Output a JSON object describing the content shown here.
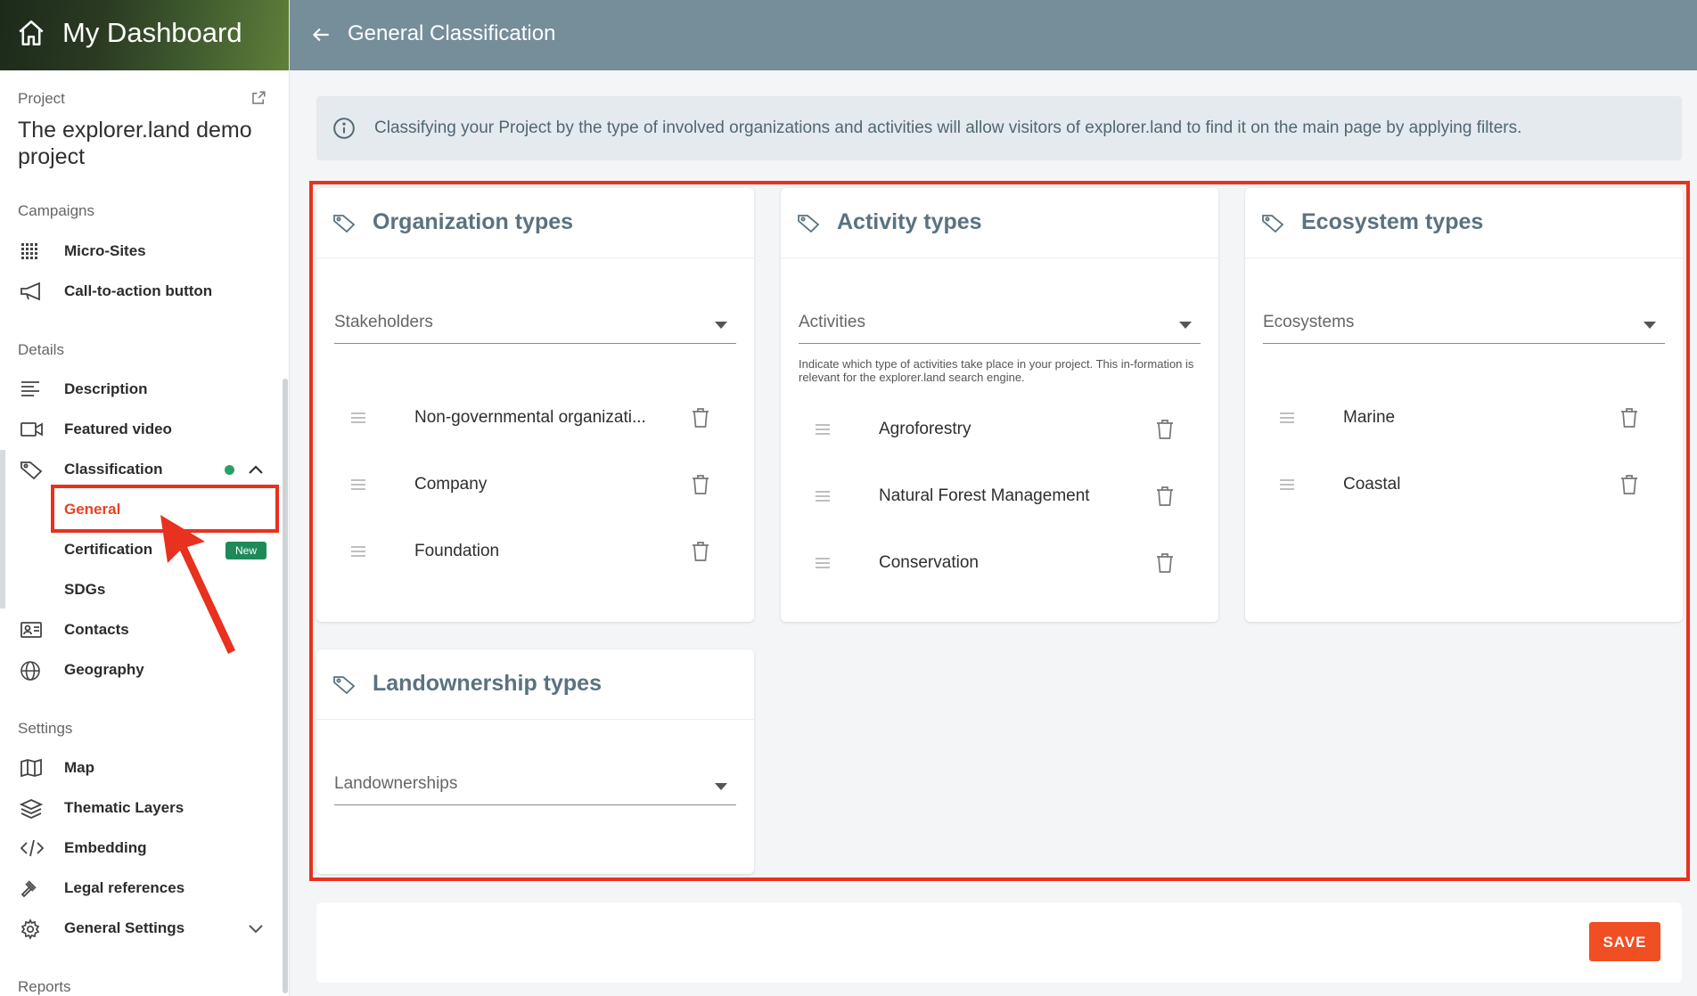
{
  "app": {
    "title": "My Dashboard"
  },
  "project": {
    "label": "Project",
    "name": "The explorer.land demo project"
  },
  "sidebar": {
    "campaigns_label": "Campaigns",
    "campaigns": [
      {
        "label": "Micro-Sites",
        "icon": "grid-icon"
      },
      {
        "label": "Call-to-action button",
        "icon": "megaphone-icon"
      }
    ],
    "details_label": "Details",
    "details": [
      {
        "label": "Description",
        "icon": "text-lines-icon"
      },
      {
        "label": "Featured video",
        "icon": "video-icon"
      },
      {
        "label": "Classification",
        "icon": "tag-icon"
      }
    ],
    "classification_sub": [
      {
        "label": "General",
        "active": true
      },
      {
        "label": "Certification",
        "badge": "New"
      },
      {
        "label": "SDGs"
      }
    ],
    "details_more": [
      {
        "label": "Contacts",
        "icon": "contact-card-icon"
      },
      {
        "label": "Geography",
        "icon": "globe-icon"
      }
    ],
    "settings_label": "Settings",
    "settings": [
      {
        "label": "Map",
        "icon": "map-icon"
      },
      {
        "label": "Thematic Layers",
        "icon": "layers-icon"
      },
      {
        "label": "Embedding",
        "icon": "code-icon"
      },
      {
        "label": "Legal references",
        "icon": "gavel-icon"
      },
      {
        "label": "General Settings",
        "icon": "gear-icon"
      }
    ],
    "reports_label": "Reports"
  },
  "header": {
    "title": "General Classification"
  },
  "info": {
    "text": "Classifying your Project by the type of involved organizations and activities will allow visitors of explorer.land to find it on the main page by applying filters."
  },
  "cards": {
    "organization": {
      "title": "Organization types",
      "select": "Stakeholders",
      "items": [
        "Non-governmental organizati...",
        "Company",
        "Foundation"
      ]
    },
    "activity": {
      "title": "Activity types",
      "select": "Activities",
      "hint": "Indicate which type of activities take place in your project. This in-formation is relevant for the explorer.land search engine.",
      "items": [
        "Agroforestry",
        "Natural Forest Management",
        "Conservation"
      ]
    },
    "ecosystem": {
      "title": "Ecosystem types",
      "select": "Ecosystems",
      "items": [
        "Marine",
        "Coastal"
      ]
    },
    "landownership": {
      "title": "Landownership types",
      "select": "Landownerships",
      "items": []
    }
  },
  "footer": {
    "save_label": "SAVE"
  },
  "colors": {
    "accent": "#f04e23",
    "header": "#768d9a",
    "highlight": "#e8311f",
    "badge": "#1e8a5a"
  }
}
